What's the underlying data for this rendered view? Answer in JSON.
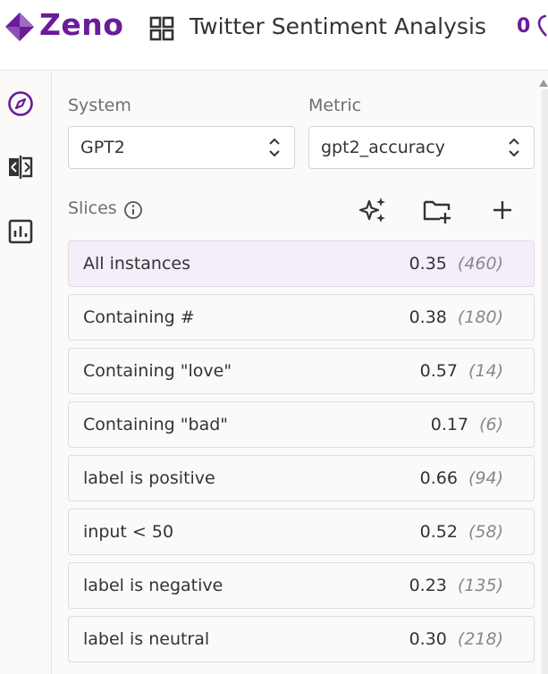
{
  "header": {
    "app_name": "Zeno",
    "project_title": "Twitter Sentiment Analysis",
    "count": "0",
    "brand_color": "#6a1b9a"
  },
  "sidebar": {
    "items": [
      {
        "icon": "compass-icon",
        "active": true
      },
      {
        "icon": "compare-icon",
        "active": false
      },
      {
        "icon": "chart-icon",
        "active": false
      }
    ]
  },
  "controls": {
    "system_label": "System",
    "system_value": "GPT2",
    "metric_label": "Metric",
    "metric_value": "gpt2_accuracy"
  },
  "slices": {
    "label": "Slices",
    "toolbar": [
      "sparkle-icon",
      "new-folder-icon",
      "plus-icon"
    ],
    "rows": [
      {
        "name": "All instances",
        "value": "0.35",
        "size": "(460)",
        "selected": true
      },
      {
        "name": "Containing #",
        "value": "0.38",
        "size": "(180)",
        "selected": false
      },
      {
        "name": "Containing \"love\"",
        "value": "0.57",
        "size": "(14)",
        "selected": false
      },
      {
        "name": "Containing \"bad\"",
        "value": "0.17",
        "size": "(6)",
        "selected": false
      },
      {
        "name": "label is positive",
        "value": "0.66",
        "size": "(94)",
        "selected": false
      },
      {
        "name": "input < 50",
        "value": "0.52",
        "size": "(58)",
        "selected": false
      },
      {
        "name": "label is negative",
        "value": "0.23",
        "size": "(135)",
        "selected": false
      },
      {
        "name": "label is neutral",
        "value": "0.30",
        "size": "(218)",
        "selected": false
      }
    ]
  }
}
